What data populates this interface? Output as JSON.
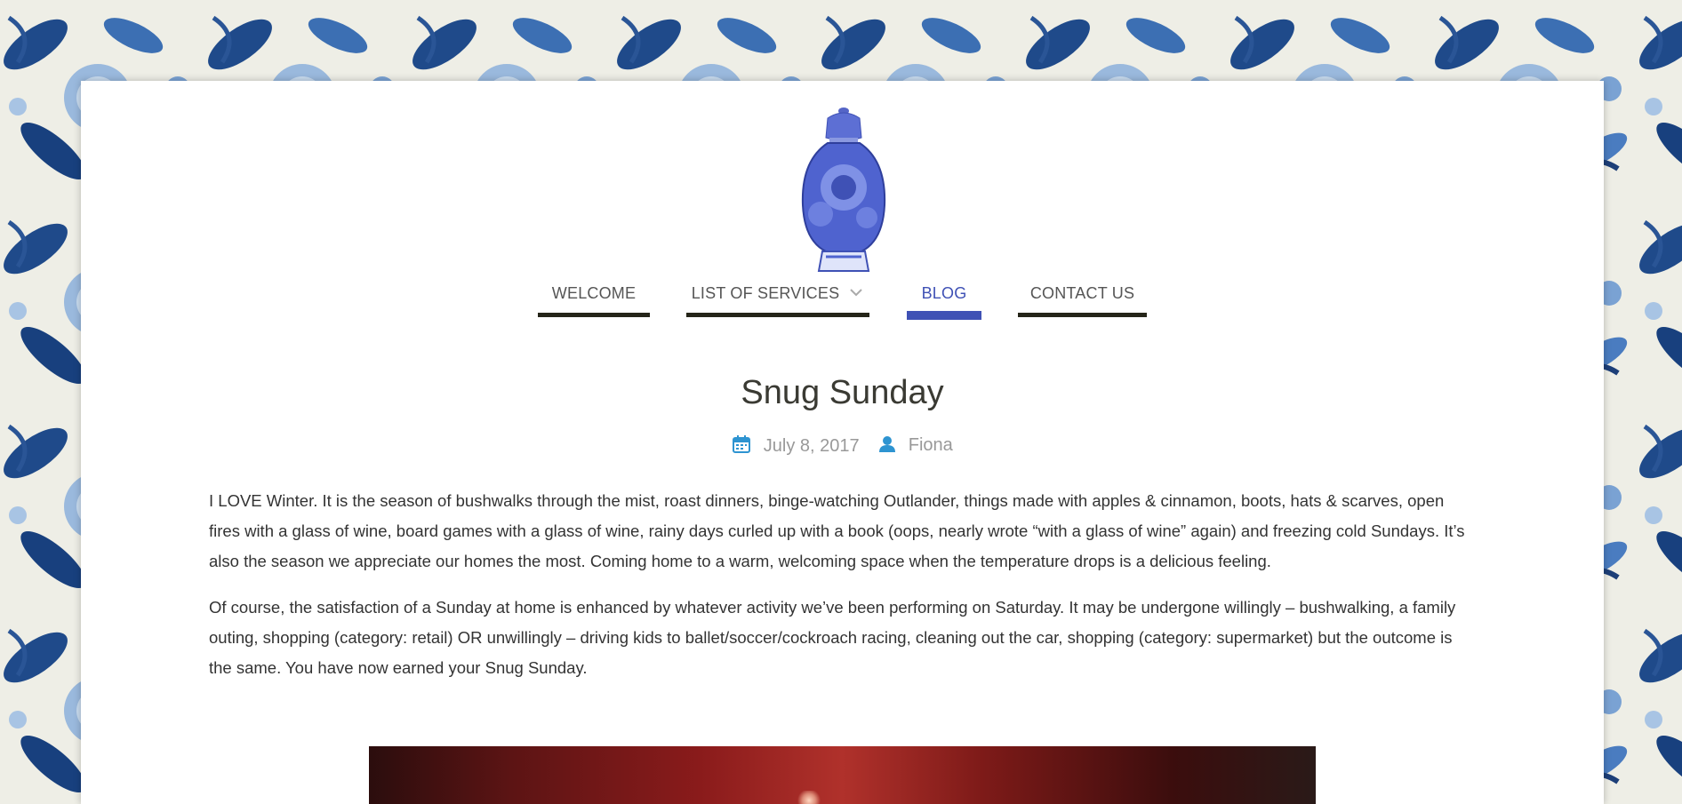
{
  "site": {
    "logo_name": "ginger-jar-logo",
    "brand_color": "#3f51b5",
    "accent_icon_color": "#2e94d1"
  },
  "nav": {
    "items": [
      {
        "label": "WELCOME",
        "active": false
      },
      {
        "label": "LIST OF SERVICES",
        "active": false,
        "has_dropdown": true
      },
      {
        "label": "BLOG",
        "active": true
      },
      {
        "label": "CONTACT US",
        "active": false
      }
    ]
  },
  "post": {
    "title": "Snug Sunday",
    "date": "July 8, 2017",
    "author": "Fiona",
    "date_icon": "calendar-icon",
    "author_icon": "user-icon",
    "paragraphs": [
      "I LOVE Winter. It is the season of bushwalks through the mist, roast dinners, binge-watching Outlander, things made with apples & cinnamon, boots, hats & scarves, open fires with a glass of wine, board games with a glass of wine, rainy days curled up with a book (oops, nearly wrote “with a glass of wine” again) and freezing cold Sundays. It’s also the season we appreciate our homes the most. Coming home to a warm, welcoming space when the temperature drops is a delicious feeling.",
      "Of course, the satisfaction of a Sunday at home is enhanced by whatever activity we’ve been performing on Saturday. It may be undergone willingly – bushwalking, a family outing, shopping (category: retail) OR unwillingly – driving kids to ballet/soccer/cockroach racing, cleaning out the car, shopping (category: supermarket) but the outcome is the same. You have now earned your Snug Sunday."
    ]
  }
}
